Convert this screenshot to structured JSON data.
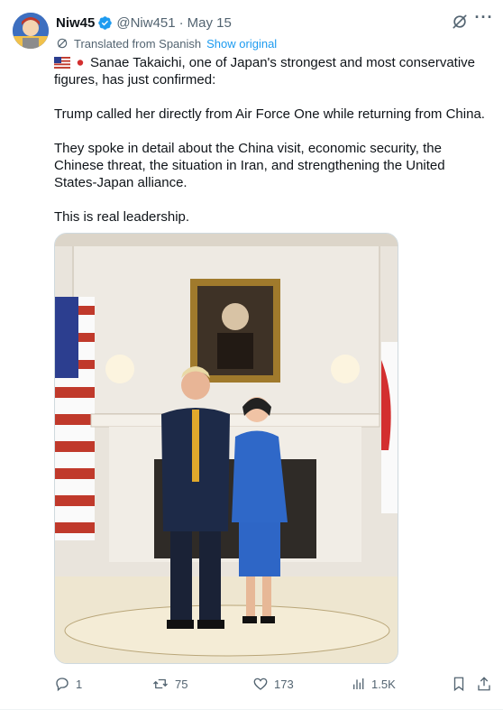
{
  "author": {
    "name": "Niw45",
    "handle": "@Niw451",
    "separator": "·",
    "date": "May 15"
  },
  "translation": {
    "label": "Translated from Spanish",
    "show_original": "Show original"
  },
  "tweet": {
    "line1": "Sanae Takaichi, one of Japan's strongest and most conservative figures, has just confirmed:",
    "line2": "Trump called her directly from Air Force One while returning from China.",
    "line3": "They spoke in detail about the China visit, economic security, the Chinese threat, the situation in Iran, and strengthening the United States-Japan alliance.",
    "line4": "This is real leadership."
  },
  "actions": {
    "replies": "1",
    "reposts": "75",
    "likes": "173",
    "views": "1.5K"
  },
  "colors": {
    "link": "#1d9bf0",
    "muted": "#536471",
    "verified": "#1d9bf0",
    "text": "#0f1419"
  },
  "icons": [
    "verified-badge-icon",
    "grok-icon",
    "more-icon",
    "translate-icon",
    "us-flag-icon",
    "japan-flag-icon",
    "reply-icon",
    "repost-icon",
    "like-icon",
    "views-icon",
    "bookmark-icon",
    "share-icon"
  ]
}
